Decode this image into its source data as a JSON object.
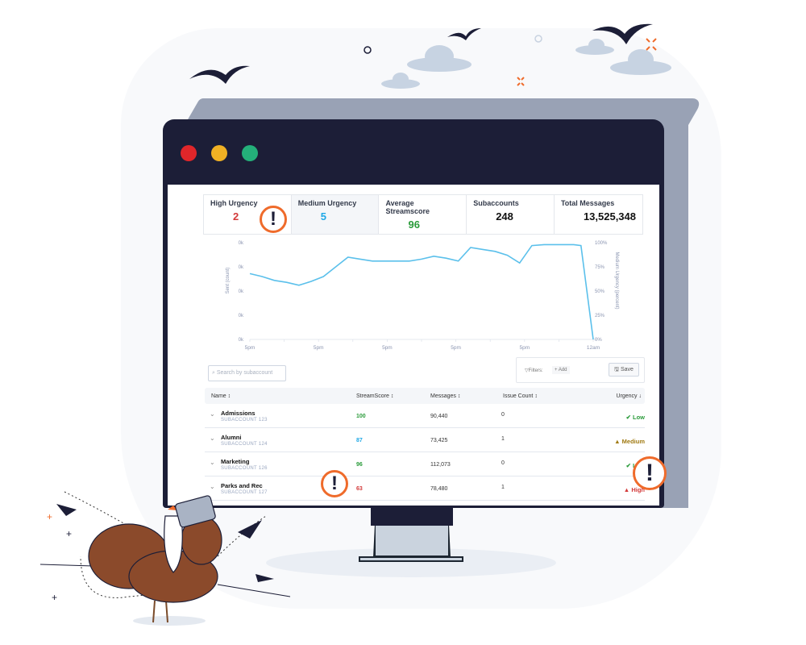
{
  "window": {
    "controls": [
      {
        "name": "close",
        "color": "#e0262a"
      },
      {
        "name": "minimize",
        "color": "#f0b124"
      },
      {
        "name": "maximize",
        "color": "#24b07a"
      }
    ]
  },
  "stats": [
    {
      "label": "High Urgency",
      "value": "2",
      "color": "#d33a3a"
    },
    {
      "label": "Medium Urgency",
      "value": "5",
      "color": "#1fa8e6"
    },
    {
      "label": "Average Streamscore",
      "value": "96",
      "color": "#2a9b3a"
    },
    {
      "label": "Subaccounts",
      "value": "248",
      "color": "#111111"
    },
    {
      "label": "Total Messages",
      "value": "13,525,348",
      "color": "#111111"
    }
  ],
  "chart_data": {
    "type": "line",
    "title": "",
    "xlabel": "",
    "ylabel": "Sent (count)",
    "y2label": "Medium Urgency (percent)",
    "x_ticks": [
      "5pm",
      "5pm",
      "5pm",
      "5pm",
      "5pm",
      "12am"
    ],
    "y_ticks": [
      "0k",
      "0k",
      "0k",
      "0k",
      "0k"
    ],
    "y2_ticks": [
      "0%",
      "25%",
      "50%",
      "75%",
      "100%"
    ],
    "y2lim": [
      0,
      100
    ],
    "series": [
      {
        "name": "Medium Urgency",
        "color": "#5bc0eb",
        "x": [
          0,
          0.5,
          1,
          1.5,
          2,
          2.5,
          3,
          3.5,
          4,
          4.5,
          5,
          5.5,
          6,
          6.5,
          7,
          7.5,
          8,
          8.5,
          9,
          9.5,
          10,
          10.5,
          11,
          11.5,
          12,
          12.5,
          13,
          13.2,
          13.5,
          14
        ],
        "values": [
          68,
          65,
          61,
          59,
          56,
          60,
          65,
          75,
          85,
          83,
          81,
          81,
          81,
          81,
          83,
          86,
          84,
          81,
          95,
          93,
          91,
          87,
          79,
          97,
          98,
          98,
          98,
          98,
          97,
          0
        ]
      }
    ]
  },
  "toolbar": {
    "search_placeholder": "Search by subaccount",
    "filters_label": "Filters:",
    "add_label": "+ Add",
    "save_label": "Save"
  },
  "table": {
    "headers": [
      "Name",
      "StreamScore",
      "Messages",
      "Issue Count",
      "Urgency"
    ],
    "rows": [
      {
        "name": "Admissions",
        "sub": "SUBACCOUNT 123",
        "score": "100",
        "score_color": "#2a9b3a",
        "messages": "90,440",
        "issues": "0",
        "urgency": "Low",
        "urgency_icon": "✔",
        "urgency_color": "#2a9b3a"
      },
      {
        "name": "Alumni",
        "sub": "SUBACCOUNT 124",
        "score": "87",
        "score_color": "#1fa8e6",
        "messages": "73,425",
        "issues": "1",
        "urgency": "Medium",
        "urgency_icon": "▲",
        "urgency_color": "#a07a12"
      },
      {
        "name": "Marketing",
        "sub": "SUBACCOUNT 126",
        "score": "96",
        "score_color": "#2a9b3a",
        "messages": "112,073",
        "issues": "0",
        "urgency": "Low",
        "urgency_icon": "✔",
        "urgency_color": "#2a9b3a"
      },
      {
        "name": "Parks and Rec",
        "sub": "SUBACCOUNT 127",
        "score": "63",
        "score_color": "#d33a3a",
        "messages": "78,480",
        "issues": "1",
        "urgency": "High",
        "urgency_icon": "▲",
        "urgency_color": "#d33a3a"
      }
    ]
  },
  "alerts": {
    "glyph": "!"
  }
}
